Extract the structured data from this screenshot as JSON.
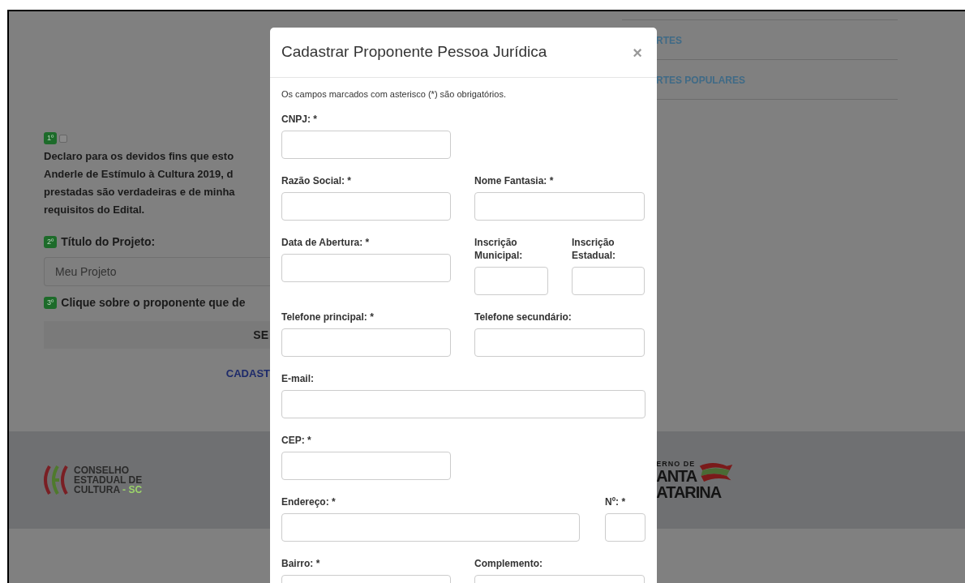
{
  "background": {
    "step1": {
      "badge": "1º",
      "checked": false,
      "lines": [
        "Declaro para os devidos fins que esto",
        "Anderle de Estímulo à Cultura 2019, d",
        "prestadas são verdadeiras e de minha",
        "requisitos do Edital."
      ]
    },
    "step2": {
      "badge": "2º",
      "label": "Título do Projeto:",
      "value": "Meu Projeto"
    },
    "step3": {
      "badge": "3º",
      "label": "Clique sobre o proponente que de"
    },
    "select_button": "SE",
    "register_link": "CADAST",
    "nav_items": [
      "RTES",
      "RTES POPULARES"
    ],
    "footer": {
      "left_logo": [
        "CONSELHO",
        "ESTADUAL DE",
        "CULTURA"
      ],
      "left_logo_suffix": "- SC",
      "right_logo": [
        "ERNO DE",
        "ANTA",
        "ATARINA"
      ]
    }
  },
  "modal": {
    "title": "Cadastrar Proponente Pessoa Jurídica",
    "close": "×",
    "note": "Os campos marcados com asterisco (*) são obrigatórios.",
    "rows": [
      {
        "kind": "single",
        "fields": [
          "CNPJ: *"
        ]
      },
      {
        "kind": "pair",
        "fields": [
          "Razão Social: *",
          "Nome Fantasia: *"
        ]
      },
      {
        "kind": "triple",
        "fields": [
          "Data de Abertura: *",
          "Inscrição Municipal:",
          "Inscrição Estadual:"
        ]
      },
      {
        "kind": "pair",
        "fields": [
          "Telefone principal: *",
          "Telefone secundário:"
        ]
      },
      {
        "kind": "full",
        "fields": [
          "E-mail:"
        ]
      },
      {
        "kind": "single",
        "fields": [
          "CEP: *"
        ]
      },
      {
        "kind": "address",
        "fields": [
          "Endereço: *",
          "Nº: *"
        ]
      },
      {
        "kind": "pair",
        "fields": [
          "Bairro: *",
          "Complemento:"
        ]
      }
    ]
  }
}
